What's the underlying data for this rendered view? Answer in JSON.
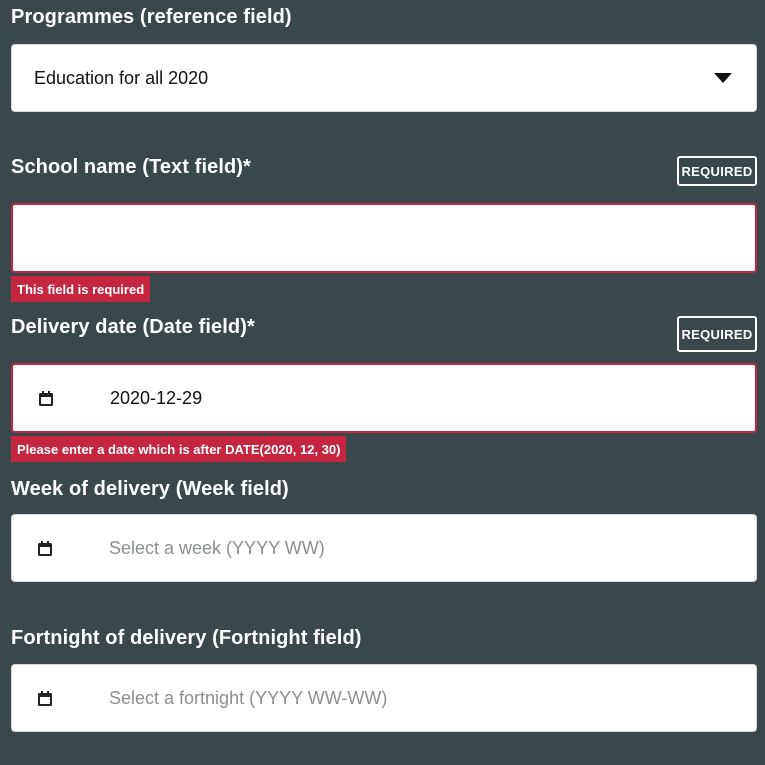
{
  "programmes": {
    "label": "Programmes (reference field)",
    "selected": "Education for all 2020"
  },
  "school_name": {
    "label": "School name (Text field)*",
    "badge": "REQUIRED",
    "value": "",
    "error": "This field is required"
  },
  "delivery_date": {
    "label": "Delivery date (Date field)*",
    "badge": "REQUIRED",
    "value": "2020-12-29",
    "error": "Please enter a date which is after DATE(2020, 12, 30)",
    "icon": "calendar-icon"
  },
  "week_of_delivery": {
    "label": "Week of delivery (Week field)",
    "placeholder": "Select a week (YYYY WW)",
    "icon": "calendar-icon"
  },
  "fortnight_of_delivery": {
    "label": "Fortnight of delivery (Fortnight field)",
    "placeholder": "Select a fortnight (YYYY WW-WW)",
    "icon": "calendar-icon"
  },
  "colors": {
    "background": "#3a484b",
    "error": "#c4263f",
    "field": "#ffffff"
  }
}
